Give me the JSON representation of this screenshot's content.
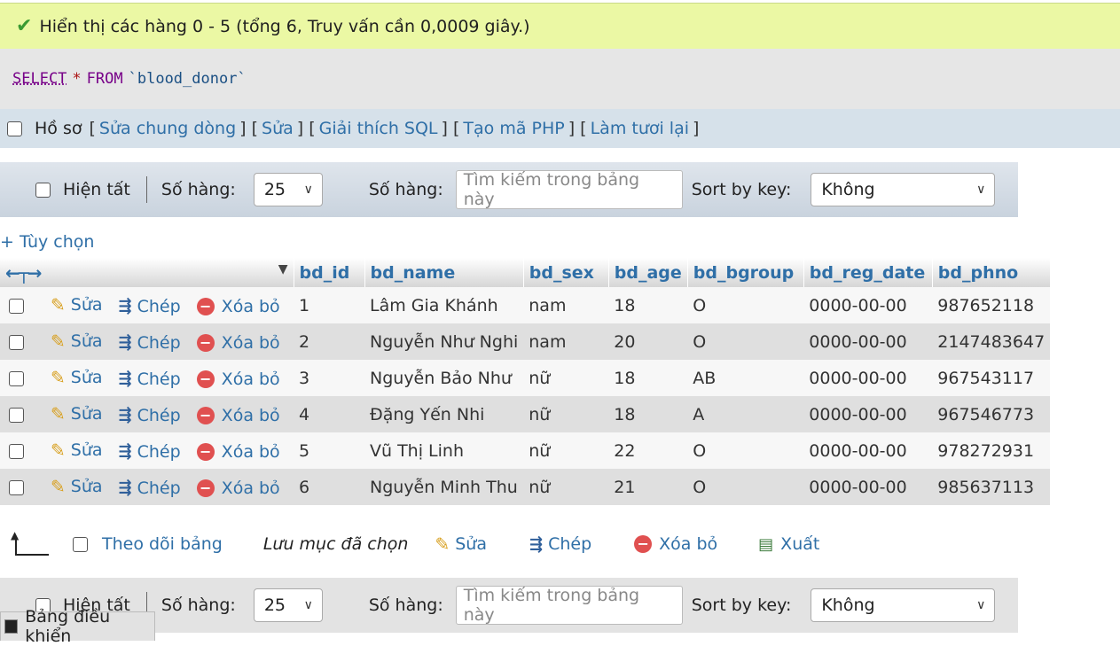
{
  "success_message": "Hiển thị các hàng 0 - 5 (tổng 6, Truy vấn cần 0,0009 giây.)",
  "sql": {
    "select": "SELECT",
    "star": "*",
    "from": "FROM",
    "table": "`blood_donor`"
  },
  "links": {
    "profile": "Hồ sơ",
    "inline_edit": "Sửa chung dòng",
    "edit": "Sửa",
    "explain": "Giải thích SQL",
    "create_php": "Tạo mã PHP",
    "refresh": "Làm tươi lại"
  },
  "nav": {
    "show_all": "Hiện tất",
    "rows_label": "Số hàng:",
    "rows_value": "25",
    "filter_label": "Số hàng:",
    "search_placeholder": "Tìm kiếm trong bảng này",
    "sort_label": "Sort by key:",
    "sort_value": "Không"
  },
  "options_link": "+ Tùy chọn",
  "columns": [
    "bd_id",
    "bd_name",
    "bd_sex",
    "bd_age",
    "bd_bgroup",
    "bd_reg_date",
    "bd_phno"
  ],
  "row_actions": {
    "edit": "Sửa",
    "copy": "Chép",
    "delete": "Xóa bỏ"
  },
  "rows": [
    {
      "bd_id": "1",
      "bd_name": "Lâm Gia Khánh",
      "bd_sex": "nam",
      "bd_age": "18",
      "bd_bgroup": "O",
      "bd_reg_date": "0000-00-00",
      "bd_phno": "987652118"
    },
    {
      "bd_id": "2",
      "bd_name": "Nguyễn Như Nghi",
      "bd_sex": "nam",
      "bd_age": "20",
      "bd_bgroup": "O",
      "bd_reg_date": "0000-00-00",
      "bd_phno": "2147483647"
    },
    {
      "bd_id": "3",
      "bd_name": "Nguyễn Bảo Như",
      "bd_sex": "nữ",
      "bd_age": "18",
      "bd_bgroup": "AB",
      "bd_reg_date": "0000-00-00",
      "bd_phno": "967543117"
    },
    {
      "bd_id": "4",
      "bd_name": "Đặng Yến Nhi",
      "bd_sex": "nữ",
      "bd_age": "18",
      "bd_bgroup": "A",
      "bd_reg_date": "0000-00-00",
      "bd_phno": "967546773"
    },
    {
      "bd_id": "5",
      "bd_name": "Vũ Thị Linh",
      "bd_sex": "nữ",
      "bd_age": "22",
      "bd_bgroup": "O",
      "bd_reg_date": "0000-00-00",
      "bd_phno": "978272931"
    },
    {
      "bd_id": "6",
      "bd_name": "Nguyễn Minh Thu",
      "bd_sex": "nữ",
      "bd_age": "21",
      "bd_bgroup": "O",
      "bd_reg_date": "0000-00-00",
      "bd_phno": "985637113"
    }
  ],
  "bulk": {
    "watch_table": "Theo dõi bảng",
    "with_selected": "Lưu mục đã chọn",
    "edit": "Sửa",
    "copy": "Chép",
    "delete": "Xóa bỏ",
    "export": "Xuất"
  },
  "console": "Bảng điều khiển"
}
